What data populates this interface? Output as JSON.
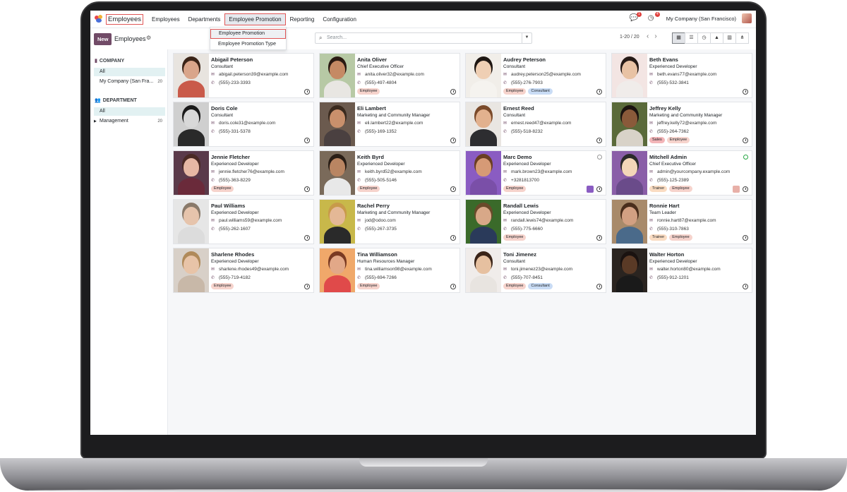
{
  "nav": {
    "brand": "Employees",
    "items": [
      "Employees",
      "Departments",
      "Employee Promotion",
      "Reporting",
      "Configuration"
    ],
    "company": "My Company (San Francisco)",
    "chat_count": "1",
    "activity_count": "4"
  },
  "dropdown": {
    "items": [
      "Employee Promotion",
      "Employee Promotion Type"
    ]
  },
  "control": {
    "new_label": "New",
    "title": "Employees",
    "search_placeholder": "Search...",
    "pager": "1-20 / 20"
  },
  "sidebar": {
    "company_heading": "COMPANY",
    "company_items": [
      {
        "label": "All",
        "count": ""
      },
      {
        "label": "My Company (San Fra...",
        "count": "20"
      }
    ],
    "department_heading": "DEPARTMENT",
    "department_items": [
      {
        "label": "All",
        "count": ""
      },
      {
        "label": "Management",
        "count": "20"
      }
    ]
  },
  "colors": {
    "accent": "#714b67",
    "highlight": "#e05656",
    "tag_employee": "#f6d3cc",
    "tag_consultant": "#c9dcf5",
    "tag_trainer": "#fadcc2",
    "tag_sales": "#f3b5b8"
  },
  "employees": [
    {
      "name": "Abigail Peterson",
      "job": "Consultant",
      "email": "abigail.peterson39@example.com",
      "phone": "(555)-233-3393",
      "tags": [],
      "skin": "#d9a58a",
      "hair": "#3b2418",
      "shirt": "#c95a4a",
      "bg": "#e8e4df"
    },
    {
      "name": "Anita Oliver",
      "job": "Chief Executive Officer",
      "email": "anita.oliver32@example.com",
      "phone": "(555)-497-4804",
      "tags": [
        "Employee"
      ],
      "skin": "#c58a64",
      "hair": "#2a1a12",
      "shirt": "#e8e6e2",
      "bg": "#b7c9a5"
    },
    {
      "name": "Audrey Peterson",
      "job": "Consultant",
      "email": "audrey.peterson25@example.com",
      "phone": "(555)-276-7903",
      "tags": [
        "Employee",
        "Consultant"
      ],
      "skin": "#efcfb4",
      "hair": "#1e1612",
      "shirt": "#f5f3ef",
      "bg": "#f1eee9"
    },
    {
      "name": "Beth Evans",
      "job": "Experienced Developer",
      "email": "beth.evans77@example.com",
      "phone": "(555)-532-3841",
      "tags": [],
      "skin": "#e8c2a4",
      "hair": "#251a16",
      "shirt": "#f0ecea",
      "bg": "#f3e5e3"
    },
    {
      "name": "Doris Cole",
      "job": "Consultant",
      "email": "doris.cole31@example.com",
      "phone": "(555)-331-5378",
      "tags": [],
      "skin": "#d8d8d8",
      "hair": "#1a1a1a",
      "shirt": "#2a2a2a",
      "bg": "#cfcfcf"
    },
    {
      "name": "Eli Lambert",
      "job": "Marketing and Community Manager",
      "email": "eli.lambert22@example.com",
      "phone": "(555)-169-1352",
      "tags": [],
      "skin": "#c9906c",
      "hair": "#3a2a1e",
      "shirt": "#4a4040",
      "bg": "#6b5a4e"
    },
    {
      "name": "Ernest Reed",
      "job": "Consultant",
      "email": "ernest.reed47@example.com",
      "phone": "(555)-518-8232",
      "tags": [],
      "skin": "#e2b18e",
      "hair": "#7a4a2a",
      "shirt": "#2d2d30",
      "bg": "#e9e6e2"
    },
    {
      "name": "Jeffrey Kelly",
      "job": "Marketing and Community Manager",
      "email": "jeffrey.kelly72@example.com",
      "phone": "(555)-264-7362",
      "tags": [
        "Sales",
        "Employee"
      ],
      "skin": "#8a5a3a",
      "hair": "#1c1410",
      "shirt": "#d8d2c8",
      "bg": "#5a6a3a"
    },
    {
      "name": "Jennie Fletcher",
      "job": "Experienced Developer",
      "email": "jennie.fletcher76@example.com",
      "phone": "(555)-363-8229",
      "tags": [
        "Employee"
      ],
      "skin": "#e6b8a4",
      "hair": "#4a2a24",
      "shirt": "#6a2a3a",
      "bg": "#5a3a4a"
    },
    {
      "name": "Keith Byrd",
      "job": "Experienced Developer",
      "email": "keith.byrd52@example.com",
      "phone": "(555)-505-5146",
      "tags": [
        "Employee"
      ],
      "skin": "#b98562",
      "hair": "#2a1e16",
      "shirt": "#e8e8e8",
      "bg": "#7a6a5a"
    },
    {
      "name": "Marc Demo",
      "job": "Experienced Developer",
      "email": "mark.brown23@example.com",
      "phone": "+3281813700",
      "tags": [
        "Employee"
      ],
      "skin": "#d69a76",
      "hair": "#6a3e22",
      "shirt": "#7a4fa8",
      "bg": "#8a5cc2"
    },
    {
      "name": "Mitchell Admin",
      "job": "Chief Executive Officer",
      "email": "admin@yourcompany.example.com",
      "phone": "(555)-125-2389",
      "tags": [
        "Trainer",
        "Employee"
      ],
      "skin": "#f3d7b8",
      "hair": "#2a2a2a",
      "shirt": "#6a4b8a",
      "bg": "#8a5ea8"
    },
    {
      "name": "Paul Williams",
      "job": "Experienced Developer",
      "email": "paul.williams59@example.com",
      "phone": "(555)-262-1607",
      "tags": [],
      "skin": "#e6c4ac",
      "hair": "#8a7a6a",
      "shirt": "#dcdcdc",
      "bg": "#e6e6e6"
    },
    {
      "name": "Rachel Perry",
      "job": "Marketing and Community Manager",
      "email": "jod@odoo.com",
      "phone": "(555)-267-3735",
      "tags": [],
      "skin": "#e4b896",
      "hair": "#c89a4a",
      "shirt": "#2a2a2a",
      "bg": "#c8b84a"
    },
    {
      "name": "Randall Lewis",
      "job": "Experienced Developer",
      "email": "randall.lewis74@example.com",
      "phone": "(555)-775-6660",
      "tags": [
        "Employee"
      ],
      "skin": "#d8a888",
      "hair": "#6a4a2a",
      "shirt": "#2a3a5a",
      "bg": "#3a6a2a"
    },
    {
      "name": "Ronnie Hart",
      "job": "Team Leader",
      "email": "ronnie.hart87@example.com",
      "phone": "(555)-310-7863",
      "tags": [
        "Trainer",
        "Employee"
      ],
      "skin": "#d2a082",
      "hair": "#4a2e1c",
      "shirt": "#4a6a8a",
      "bg": "#a88a6a"
    },
    {
      "name": "Sharlene Rhodes",
      "job": "Experienced Developer",
      "email": "sharlene.rhodes49@example.com",
      "phone": "(555)-719-4182",
      "tags": [
        "Employee"
      ],
      "skin": "#e8c4a8",
      "hair": "#b08a5a",
      "shirt": "#c8b8a8",
      "bg": "#d8d0c8"
    },
    {
      "name": "Tina Williamson",
      "job": "Human Resources Manager",
      "email": "tina.williamson98@example.com",
      "phone": "(555)-694-7266",
      "tags": [
        "Employee"
      ],
      "skin": "#e2a888",
      "hair": "#7a3a22",
      "shirt": "#e04a4a",
      "bg": "#f0a86a"
    },
    {
      "name": "Toni Jimenez",
      "job": "Consultant",
      "email": "toni.jimenez23@example.com",
      "phone": "(555)-707-8451",
      "tags": [
        "Employee",
        "Consultant"
      ],
      "skin": "#e6c0a0",
      "hair": "#3a2418",
      "shirt": "#e8e4e0",
      "bg": "#f0ecea"
    },
    {
      "name": "Walter Horton",
      "job": "Experienced Developer",
      "email": "walter.horton80@example.com",
      "phone": "(555)-912-1201",
      "tags": [],
      "skin": "#5a3a26",
      "hair": "#1a1210",
      "shirt": "#1a1a1a",
      "bg": "#2a2420"
    }
  ]
}
